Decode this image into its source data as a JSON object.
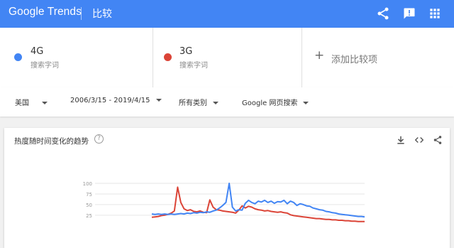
{
  "header": {
    "logo": "Google Trends",
    "title": "比较",
    "icons": [
      "share-icon",
      "feedback-icon",
      "apps-icon"
    ]
  },
  "compare": {
    "terms": [
      {
        "name": "4G",
        "type": "搜索字词",
        "color": "#4285f4"
      },
      {
        "name": "3G",
        "type": "搜索字词",
        "color": "#db4437"
      }
    ],
    "add_label": "添加比较项"
  },
  "filters": {
    "region": "美国",
    "date_range": "2006/3/15 - 2019/4/15",
    "category": "所有类别",
    "search_type": "Google 网页搜索"
  },
  "card": {
    "title": "热度随时间变化的趋势",
    "tools": [
      "download-icon",
      "embed-icon",
      "share-icon"
    ]
  },
  "chart_data": {
    "type": "line",
    "ylim": [
      0,
      100
    ],
    "yticks": [
      "100",
      "75",
      "50",
      "25"
    ],
    "series": [
      {
        "name": "4G",
        "color": "#4285f4",
        "values": [
          28,
          27,
          28,
          27,
          28,
          27,
          28,
          27,
          28,
          29,
          28,
          30,
          29,
          31,
          30,
          32,
          31,
          33,
          32,
          35,
          37,
          42,
          48,
          55,
          100,
          44,
          35,
          38,
          37,
          53,
          60,
          55,
          52,
          58,
          56,
          60,
          55,
          58,
          53,
          57,
          56,
          60,
          52,
          58,
          55,
          48,
          52,
          50,
          47,
          46,
          42,
          40,
          38,
          37,
          34,
          33,
          31,
          30,
          28,
          27,
          26,
          25,
          24,
          23,
          22,
          22,
          21
        ]
      },
      {
        "name": "3G",
        "color": "#db4437",
        "values": [
          20,
          21,
          22,
          24,
          25,
          27,
          30,
          35,
          91,
          55,
          40,
          36,
          38,
          34,
          33,
          35,
          32,
          31,
          61,
          44,
          38,
          37,
          35,
          34,
          33,
          32,
          30,
          37,
          47,
          42,
          46,
          44,
          40,
          38,
          37,
          35,
          36,
          34,
          33,
          32,
          33,
          31,
          30,
          26,
          24,
          23,
          22,
          21,
          20,
          19,
          18,
          17,
          17,
          16,
          15,
          15,
          14,
          14,
          13,
          13,
          12,
          12,
          11,
          11,
          10,
          10,
          10
        ]
      }
    ]
  }
}
